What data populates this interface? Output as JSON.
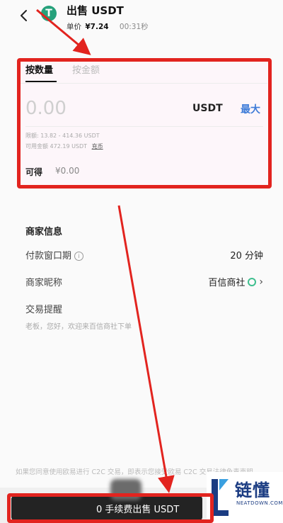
{
  "header": {
    "title": "出售 USDT",
    "price_label": "单价",
    "price_value": "¥7.24",
    "timer": "00:31秒",
    "coin_symbol": "T"
  },
  "amount_card": {
    "tab_by_quantity": "按数量",
    "tab_by_amount": "按金额",
    "placeholder": "0.00",
    "unit": "USDT",
    "max_label": "最大",
    "limit_text": "限额: 13.82 - 414.36 USDT",
    "available_text": "可用金额 472.19 USDT",
    "charge_label": "充币",
    "receive_label": "可得",
    "receive_value": "¥0.00"
  },
  "merchant": {
    "section_title": "商家信息",
    "payment_window_label": "付款窗口期",
    "payment_window_value": "20 分钟",
    "nickname_label": "商家昵称",
    "nickname_value": "百信商社",
    "reminder_label": "交易提醒",
    "reminder_text": "老板，您好，欢迎来百信商社下单"
  },
  "footer": {
    "disclaimer": "如果您同意使用欧易进行 C2C 交易，即表示您接受欧易 C2C 交易法律免责声明",
    "sell_button": "0 手续费出售 USDT"
  },
  "watermark": {
    "brand": "链懂",
    "domain": "NEATDOWN.COM"
  },
  "colors": {
    "accent_blue": "#3d7bd8",
    "annotation_red": "#e2241f",
    "usdt_green": "#26a17b",
    "button_dark": "#232323"
  }
}
